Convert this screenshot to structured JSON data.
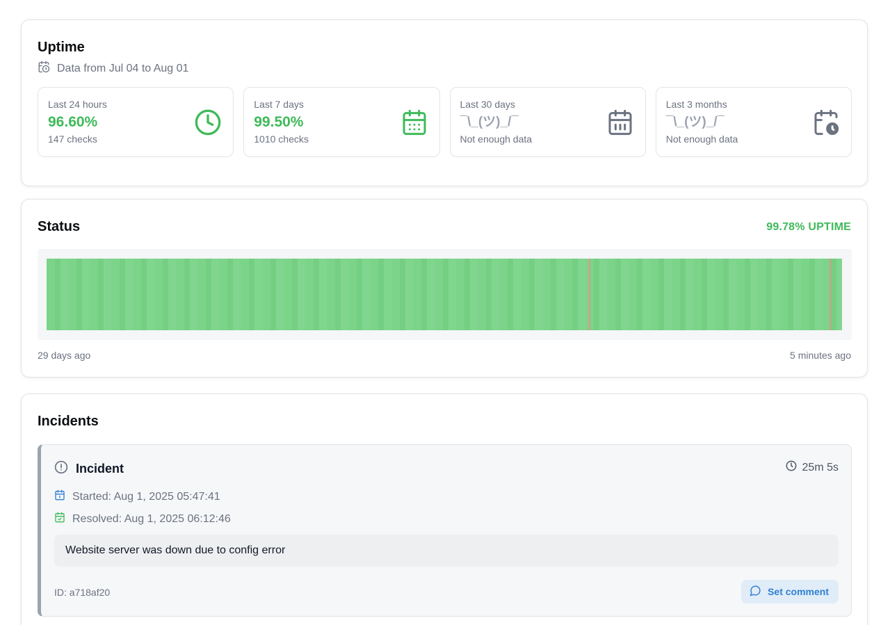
{
  "uptime": {
    "title": "Uptime",
    "range": "Data from Jul 04 to Aug 01",
    "stats": [
      {
        "label": "Last 24 hours",
        "value": "96.60%",
        "sub": "147 checks",
        "icon": "clock-icon"
      },
      {
        "label": "Last 7 days",
        "value": "99.50%",
        "sub": "1010 checks",
        "icon": "calendar-icon"
      },
      {
        "label": "Last 30 days",
        "value": "¯\\_(ツ)_/¯",
        "sub": "Not enough data",
        "icon": "calendar-days-icon"
      },
      {
        "label": "Last 3 months",
        "value": "¯\\_(ツ)_/¯",
        "sub": "Not enough data",
        "icon": "calendar-clock-icon"
      }
    ]
  },
  "status": {
    "title": "Status",
    "uptime_label": "99.78% UPTIME",
    "start_label": "29 days ago",
    "end_label": "5 minutes ago",
    "incident_marks": [
      0.682,
      0.984
    ]
  },
  "incidents": {
    "title": "Incidents",
    "items": [
      {
        "title": "Incident",
        "duration": "25m 5s",
        "started": "Started: Aug 1, 2025 05:47:41",
        "resolved": "Resolved: Aug 1, 2025 06:12:46",
        "message": "Website server was down due to config error",
        "id": "ID: a718af20",
        "comment_label": "Set comment"
      }
    ]
  },
  "colors": {
    "green": "#3fba5a",
    "bar_green": "#7cd48a",
    "incident_red": "#e8918a",
    "blue": "#2f80d1"
  }
}
